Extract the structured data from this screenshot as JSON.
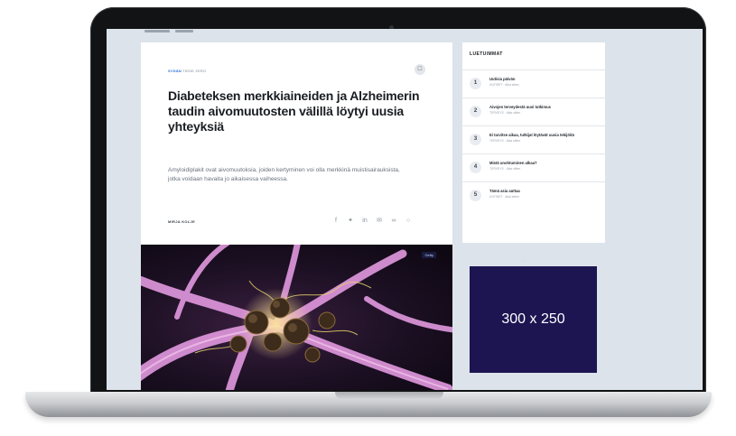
{
  "article": {
    "kicker_category": "SYDÄN",
    "kicker_sub": "TIEDE ZERO",
    "title": "Diabeteksen merkkiaineiden ja Alzheimerin taudin aivomuutosten välillä löytyi uusia yhteyksiä",
    "lead": "Amyloidiplakit ovat aivomuutoksia, joiden kertyminen voi olla merkkinä muistisairauksista, jotka voidaan havaita jo aikaisessa vaiheessa.",
    "author": "MIRJA KOLJE",
    "hero_tag": "Getty"
  },
  "sidebar": {
    "title": "LUETUIMMAT",
    "items": [
      {
        "num": "1",
        "text": "Uutisia päivän",
        "meta": "UUTISET · Aika sitten"
      },
      {
        "num": "2",
        "text": "Aivojen terveydestä uusi tutkimus",
        "meta": "TERVEYS · Aika sitten"
      },
      {
        "num": "3",
        "text": "Ei tarvitse aikaa, tutkijat löytävät uusia tekijöitä",
        "meta": "TERVEYS · Aika sitten"
      },
      {
        "num": "4",
        "text": "Mistä unohtuminen alkaa?",
        "meta": "TERVEYS · Aika sitten"
      },
      {
        "num": "5",
        "text": "Tämä asia auttaa",
        "meta": "UUTISET · Aika sitten"
      }
    ]
  },
  "ad": {
    "text": "300 x 250"
  },
  "icons": {
    "bookmark": "bookmark-icon",
    "share": [
      "facebook-icon",
      "twitter-icon",
      "linkedin-icon",
      "email-icon",
      "link-icon",
      "comment-icon"
    ]
  },
  "colors": {
    "screen_bg": "#dde3ea",
    "ad_bg": "#1d1552",
    "accent": "#2f6fd6"
  }
}
